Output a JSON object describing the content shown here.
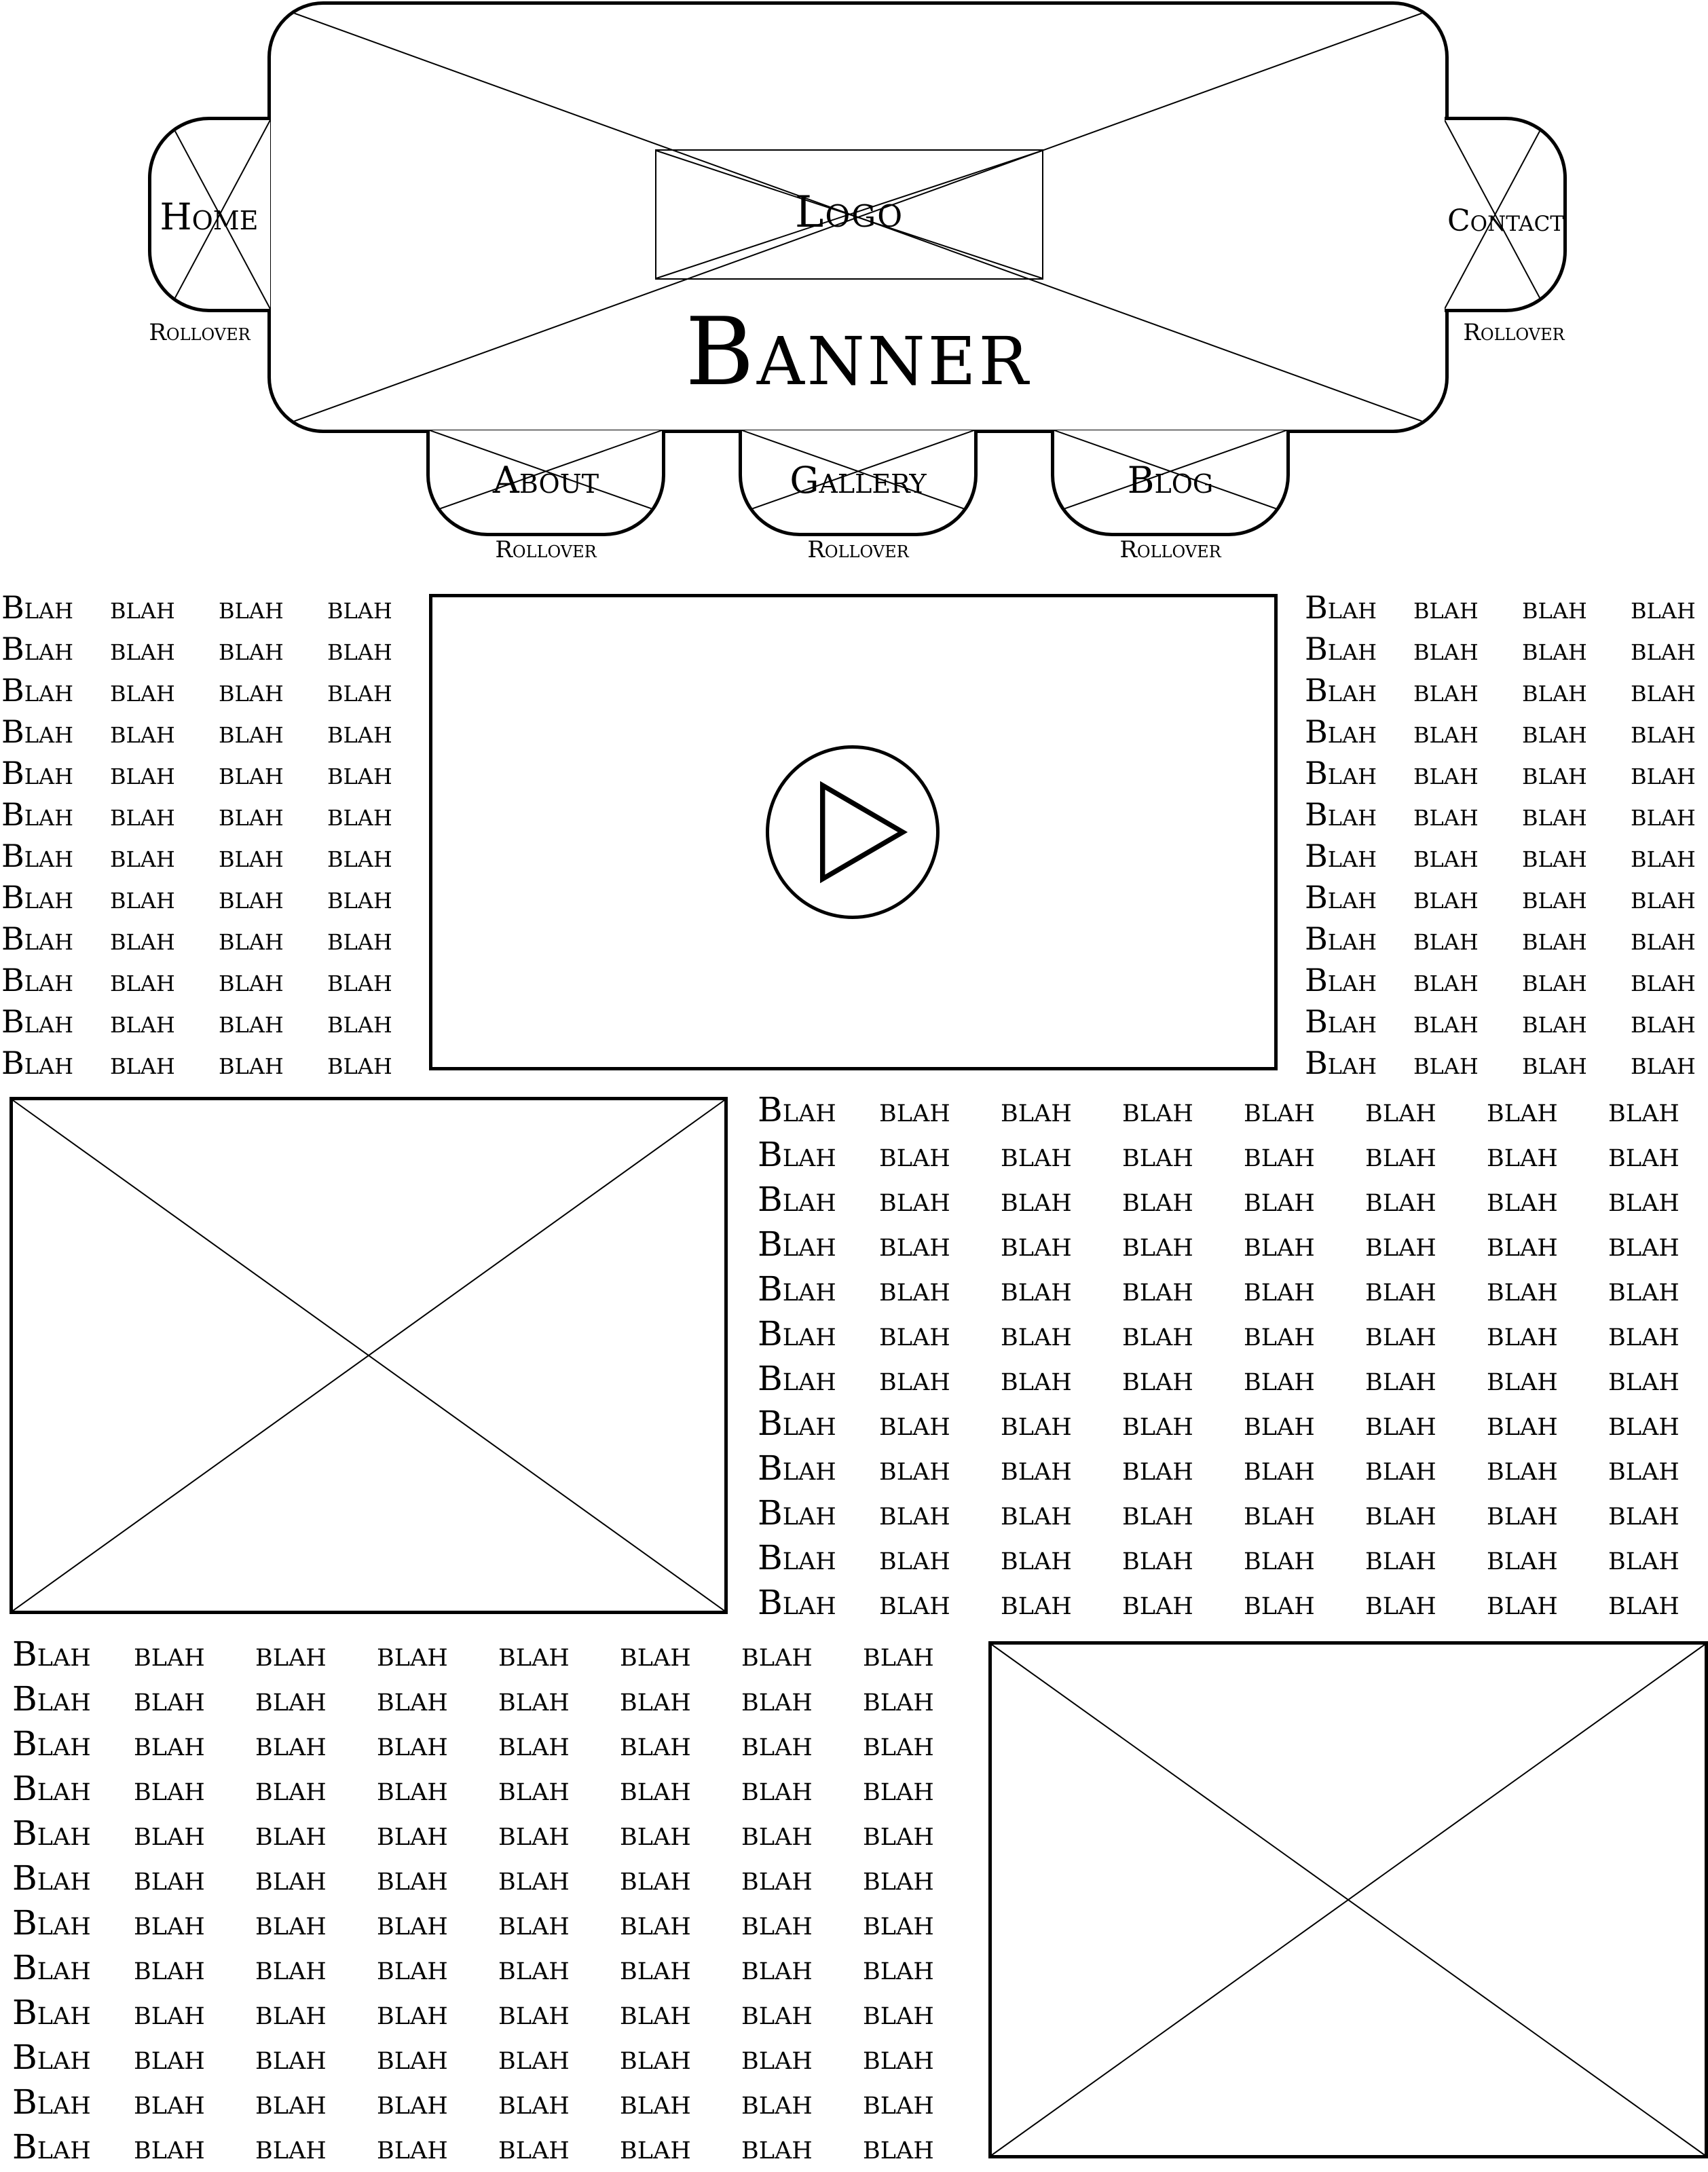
{
  "banner": {
    "title": "Banner",
    "logo": "Logo"
  },
  "nav": {
    "home": {
      "label": "Home",
      "rollover": "Rollover"
    },
    "contact": {
      "label": "Contact",
      "rollover": "Rollover"
    },
    "about": {
      "label": "About",
      "rollover": "Rollover"
    },
    "gallery": {
      "label": "Gallery",
      "rollover": "Rollover"
    },
    "blog": {
      "label": "Blog",
      "rollover": "Rollover"
    }
  },
  "content": {
    "word": "Blah",
    "filler": "blah",
    "left_column": {
      "rows": 12,
      "cols": 4
    },
    "right_column": {
      "rows": 12,
      "cols": 4
    },
    "middle_block": {
      "rows": 12,
      "cols": 8
    },
    "bottom_block": {
      "rows": 12,
      "cols": 8
    }
  },
  "video": {
    "icon": "play-icon"
  }
}
